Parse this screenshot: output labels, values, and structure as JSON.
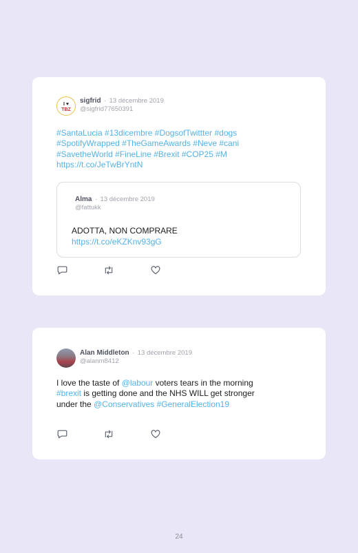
{
  "tweets": [
    {
      "author": "sigfrid",
      "separator": "·",
      "date": "13 décembre 2019",
      "handle": "@sigfrid77650391",
      "text_lines": [
        "#SantaLucia #13dicembre #DogsofTwittter #dogs",
        "#SpotifyWrapped #TheGameAwards #Neve #cani",
        "#SavetheWorld #FineLine #Brexit #COP25 #M",
        "https://t.co/JeTwBrYntN"
      ],
      "quoted": {
        "author": "Alma",
        "separator": "·",
        "date": "13 décembre 2019",
        "handle": "@fattukk",
        "text": "ADOTTA, NON COMPRARE",
        "link": "https://t.co/eKZKnv93gG"
      }
    },
    {
      "author": "Alan Middleton",
      "separator": "·",
      "date": "13 décembre 2019",
      "handle": "@alanm8412",
      "text": {
        "l1_a": "I love the taste of ",
        "l1_mention": "@labour",
        "l1_b": " voters tears in the morning",
        "l2_tag": "#brexit",
        "l2_b": " is getting done and the NHS WILL get stronger",
        "l3_a": "under the ",
        "l3_mention": "@Conservatives",
        "l3_sp": " ",
        "l3_tag": "#GeneralElection19"
      }
    }
  ],
  "icons": [
    "reply-icon",
    "retweet-icon",
    "like-icon"
  ],
  "page_number": "24",
  "colors": {
    "background": "#e8e6f7",
    "card": "#ffffff",
    "link": "#53b2e8",
    "icon": "#5b6270"
  }
}
